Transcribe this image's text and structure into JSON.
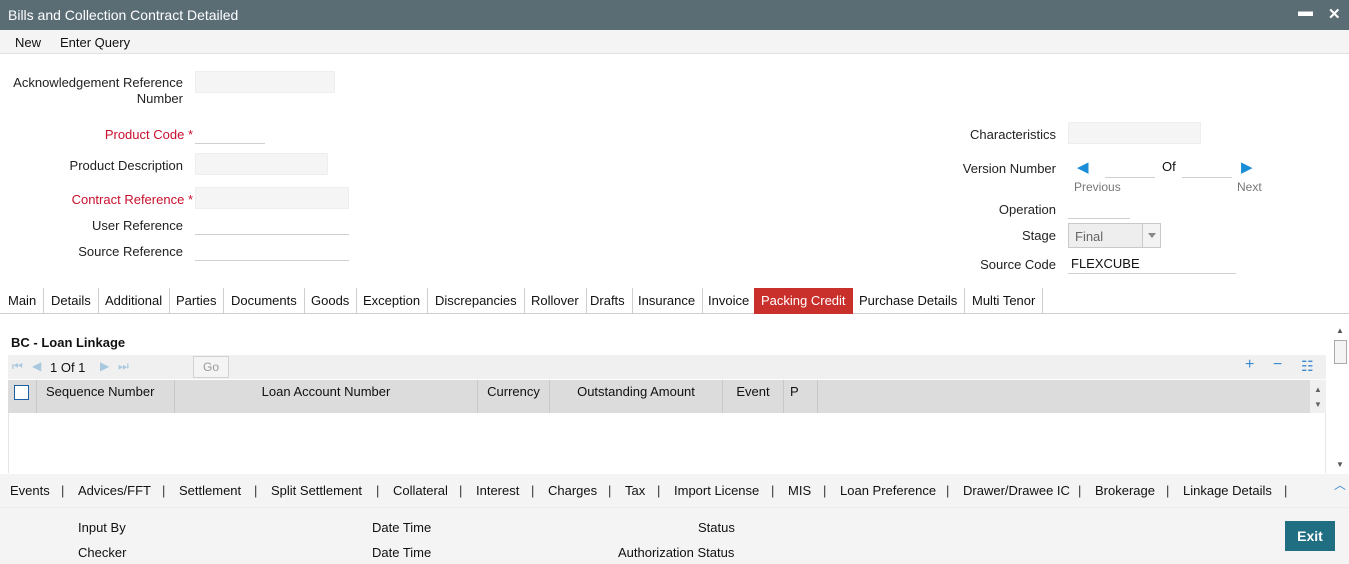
{
  "window": {
    "title": "Bills and Collection Contract Detailed",
    "minimize_glyph": "▬",
    "close_glyph": "✕"
  },
  "menu": {
    "new": "New",
    "enter_query": "Enter Query"
  },
  "form": {
    "ack_ref_label_1": "Acknowledgement Reference",
    "ack_ref_label_2": "Number",
    "product_code_label": "Product Code",
    "required_mark": "*",
    "product_description_label": "Product Description",
    "contract_reference_label": "Contract Reference",
    "user_reference_label": "User Reference",
    "source_reference_label": "Source Reference",
    "characteristics_label": "Characteristics",
    "version_number_label": "Version Number",
    "of_label": "Of",
    "previous_label": "Previous",
    "next_label": "Next",
    "operation_label": "Operation",
    "stage_label": "Stage",
    "stage_value": "Final",
    "source_code_label": "Source Code",
    "source_code_value": "FLEXCUBE"
  },
  "tabs": [
    {
      "label": "Main"
    },
    {
      "label": "Details"
    },
    {
      "label": "Additional"
    },
    {
      "label": "Parties"
    },
    {
      "label": "Documents"
    },
    {
      "label": "Goods"
    },
    {
      "label": "Exception"
    },
    {
      "label": "Discrepancies"
    },
    {
      "label": "Rollover"
    },
    {
      "label": "Drafts"
    },
    {
      "label": "Insurance"
    },
    {
      "label": "Invoice"
    },
    {
      "label": "Packing Credit",
      "active": true
    },
    {
      "label": "Purchase Details"
    },
    {
      "label": "Multi Tenor"
    }
  ],
  "loan_linkage": {
    "title": "BC - Loan Linkage",
    "pager_text": "1 Of 1",
    "go_label": "Go",
    "columns": [
      "Sequence Number",
      "Loan Account Number",
      "Currency",
      "Outstanding Amount",
      "Event",
      "P"
    ]
  },
  "sub_links": [
    "Events",
    "Advices/FFT",
    "Settlement",
    "Split Settlement",
    "Collateral",
    "Interest",
    "Charges",
    "Tax",
    "Import License",
    "MIS",
    "Loan Preference",
    "Drawer/Drawee IC",
    "Brokerage",
    "Linkage Details"
  ],
  "sub_link_separator": "|",
  "footer": {
    "input_by": "Input By",
    "checker": "Checker",
    "date_time": "Date Time",
    "status": "Status",
    "authorization_status": "Authorization Status",
    "exit_label": "Exit"
  },
  "colors": {
    "titlebar": "#5a6d75",
    "active_tab": "#c9302c",
    "exit_button": "#1f6e81",
    "required": "#c8102e",
    "nav_arrow": "#1a8dd8"
  }
}
